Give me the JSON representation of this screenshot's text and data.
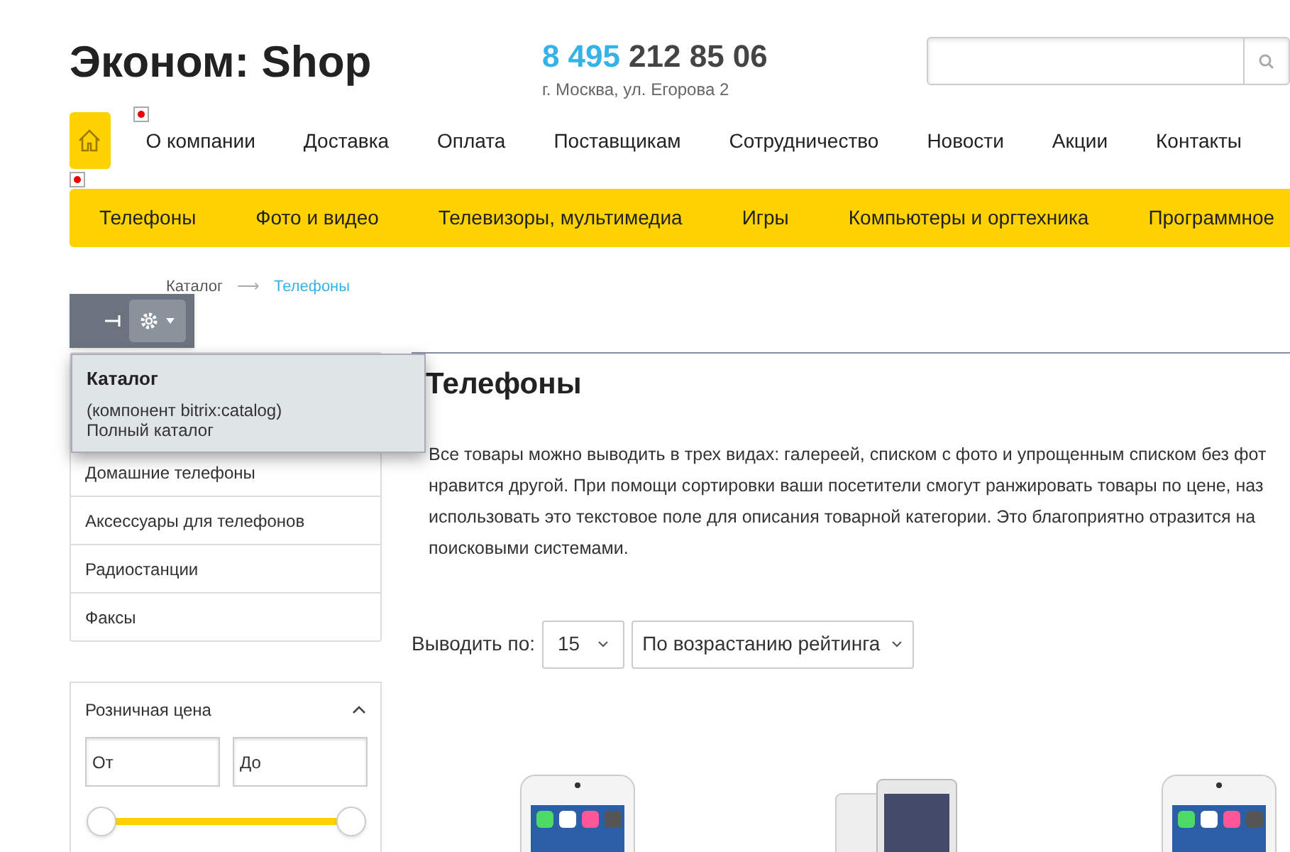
{
  "header": {
    "logo": "Эконом: Shop",
    "phone_code": "8 495",
    "phone_number": "212 85 06",
    "address": "г. Москва, ул. Егорова 2"
  },
  "top_menu": [
    {
      "label": "О компании",
      "broken_image": true
    },
    {
      "label": "Доставка",
      "broken_image": false
    },
    {
      "label": "Оплата",
      "broken_image": false
    },
    {
      "label": "Поставщикам",
      "broken_image": false
    },
    {
      "label": "Сотрудничество",
      "broken_image": false
    },
    {
      "label": "Новости",
      "broken_image": false
    },
    {
      "label": "Акции",
      "broken_image": false
    },
    {
      "label": "Контакты",
      "broken_image": false
    }
  ],
  "catalog_menu": [
    "Телефоны",
    "Фото и видео",
    "Телевизоры, мультимедиа",
    "Игры",
    "Компьютеры и оргтехника",
    "Программное"
  ],
  "breadcrumbs": {
    "separator": "⟶",
    "items": [
      {
        "label": "Каталог",
        "selected": false
      },
      {
        "label": "Телефоны",
        "selected": true
      }
    ]
  },
  "edit_popup": {
    "title": "Каталог",
    "component": "(компонент bitrix:catalog)",
    "description": "Полный каталог"
  },
  "sidebar": {
    "items": [
      "Домашние телефоны",
      "Аксессуары для телефонов",
      "Радиостанции",
      "Факсы"
    ]
  },
  "price_filter": {
    "title": "Розничная цена",
    "expanded": true,
    "from_placeholder": "От",
    "to_placeholder": "До",
    "thumbs": [
      {
        "level": 0
      },
      {
        "level": 1
      }
    ]
  },
  "page_title": "Телефоны",
  "description_lines": [
    "Все товары можно выводить в трех видах: галереей, списком с фото и упрощенным списком без фот",
    "нравится другой. При помощи сортировки ваши посетители смогут ранжировать товары по цене, наз",
    "использовать это текстовое поле для описания товарной категории. Это благоприятно отразится на",
    "поисковыми системами."
  ],
  "sorting": {
    "label": "Выводить по:",
    "per_page": "15",
    "order": "По возрастанию рейтинга"
  },
  "products": [
    {
      "kind": "iphone"
    },
    {
      "kind": "xperia"
    },
    {
      "kind": "iphone"
    }
  ]
}
